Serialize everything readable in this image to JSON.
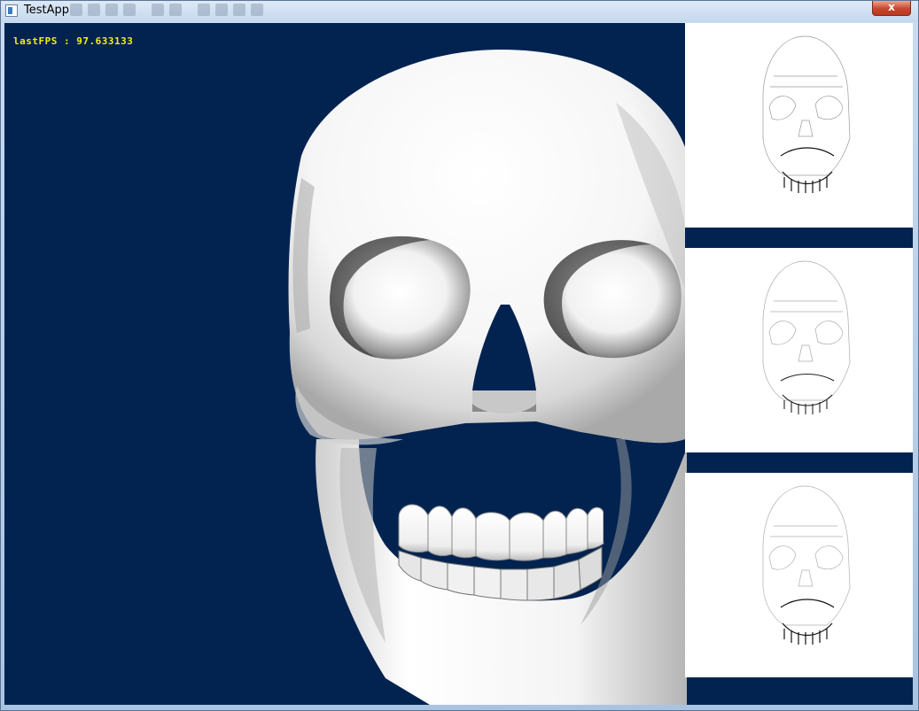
{
  "window": {
    "title": "TestApp",
    "close_label": "x",
    "close_color": "#c9452c"
  },
  "viewport": {
    "background": "#022350",
    "fps_text": "lastFPS : 97.633133",
    "fps_color": "#f2f20a"
  },
  "scene": {
    "main_object": "skull-render",
    "thumbnails": [
      {
        "label": "",
        "style": "line-sketch"
      },
      {
        "label": "",
        "style": "line-sketch"
      },
      {
        "label": "",
        "style": "line-sketch"
      }
    ]
  }
}
